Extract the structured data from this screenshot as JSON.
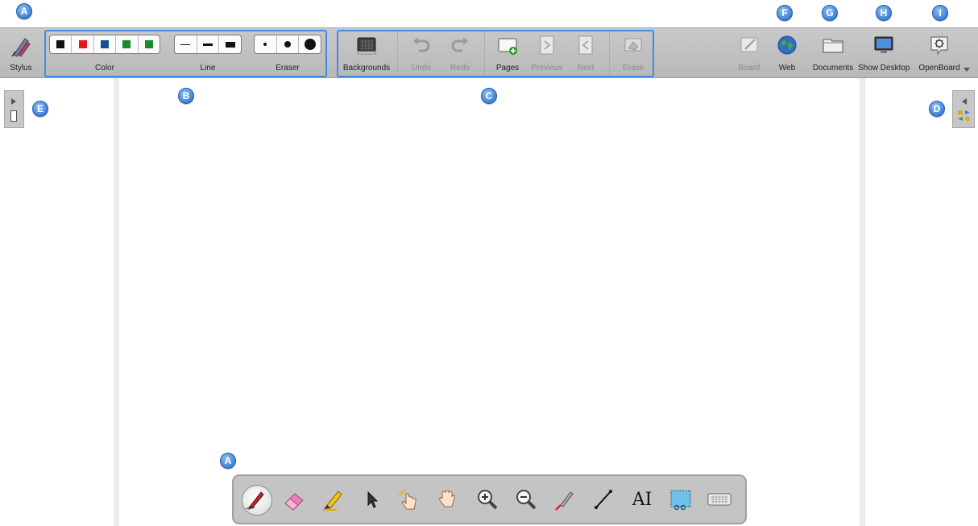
{
  "badges": {
    "top_stylus": "A",
    "bottom_bar": "A",
    "b": "B",
    "c": "C",
    "d": "D",
    "e": "E",
    "f": "F",
    "g": "G",
    "h": "H",
    "i": "I"
  },
  "toolbar": {
    "stylus_label": "Stylus",
    "color_label": "Color",
    "line_label": "Line",
    "eraser_label": "Eraser",
    "colors": [
      "#111111",
      "#e8141b",
      "#164f93",
      "#1a8a2a",
      "#1a8a2a"
    ],
    "backgrounds_label": "Backgrounds",
    "undo_label": "Undo",
    "redo_label": "Redo",
    "pages_label": "Pages",
    "previous_label": "Previous",
    "next_label": "Next",
    "erase_label": "Erase",
    "board_label": "Board",
    "web_label": "Web",
    "documents_label": "Documents",
    "show_desktop_label": "Show Desktop",
    "openboard_label": "OpenBoard"
  },
  "bottom_toolbar": {
    "tools": [
      "pen-icon",
      "eraser-icon",
      "marker-icon",
      "selector-icon",
      "interact-icon",
      "hand-icon",
      "zoom-in-icon",
      "zoom-out-icon",
      "laser-pointer-icon",
      "line-icon",
      "text-icon",
      "capture-icon",
      "keyboard-icon"
    ],
    "text_tool_glyph": "AI"
  },
  "colors": {
    "highlight": "#3b8eea",
    "badge": "#3f7fd6"
  }
}
